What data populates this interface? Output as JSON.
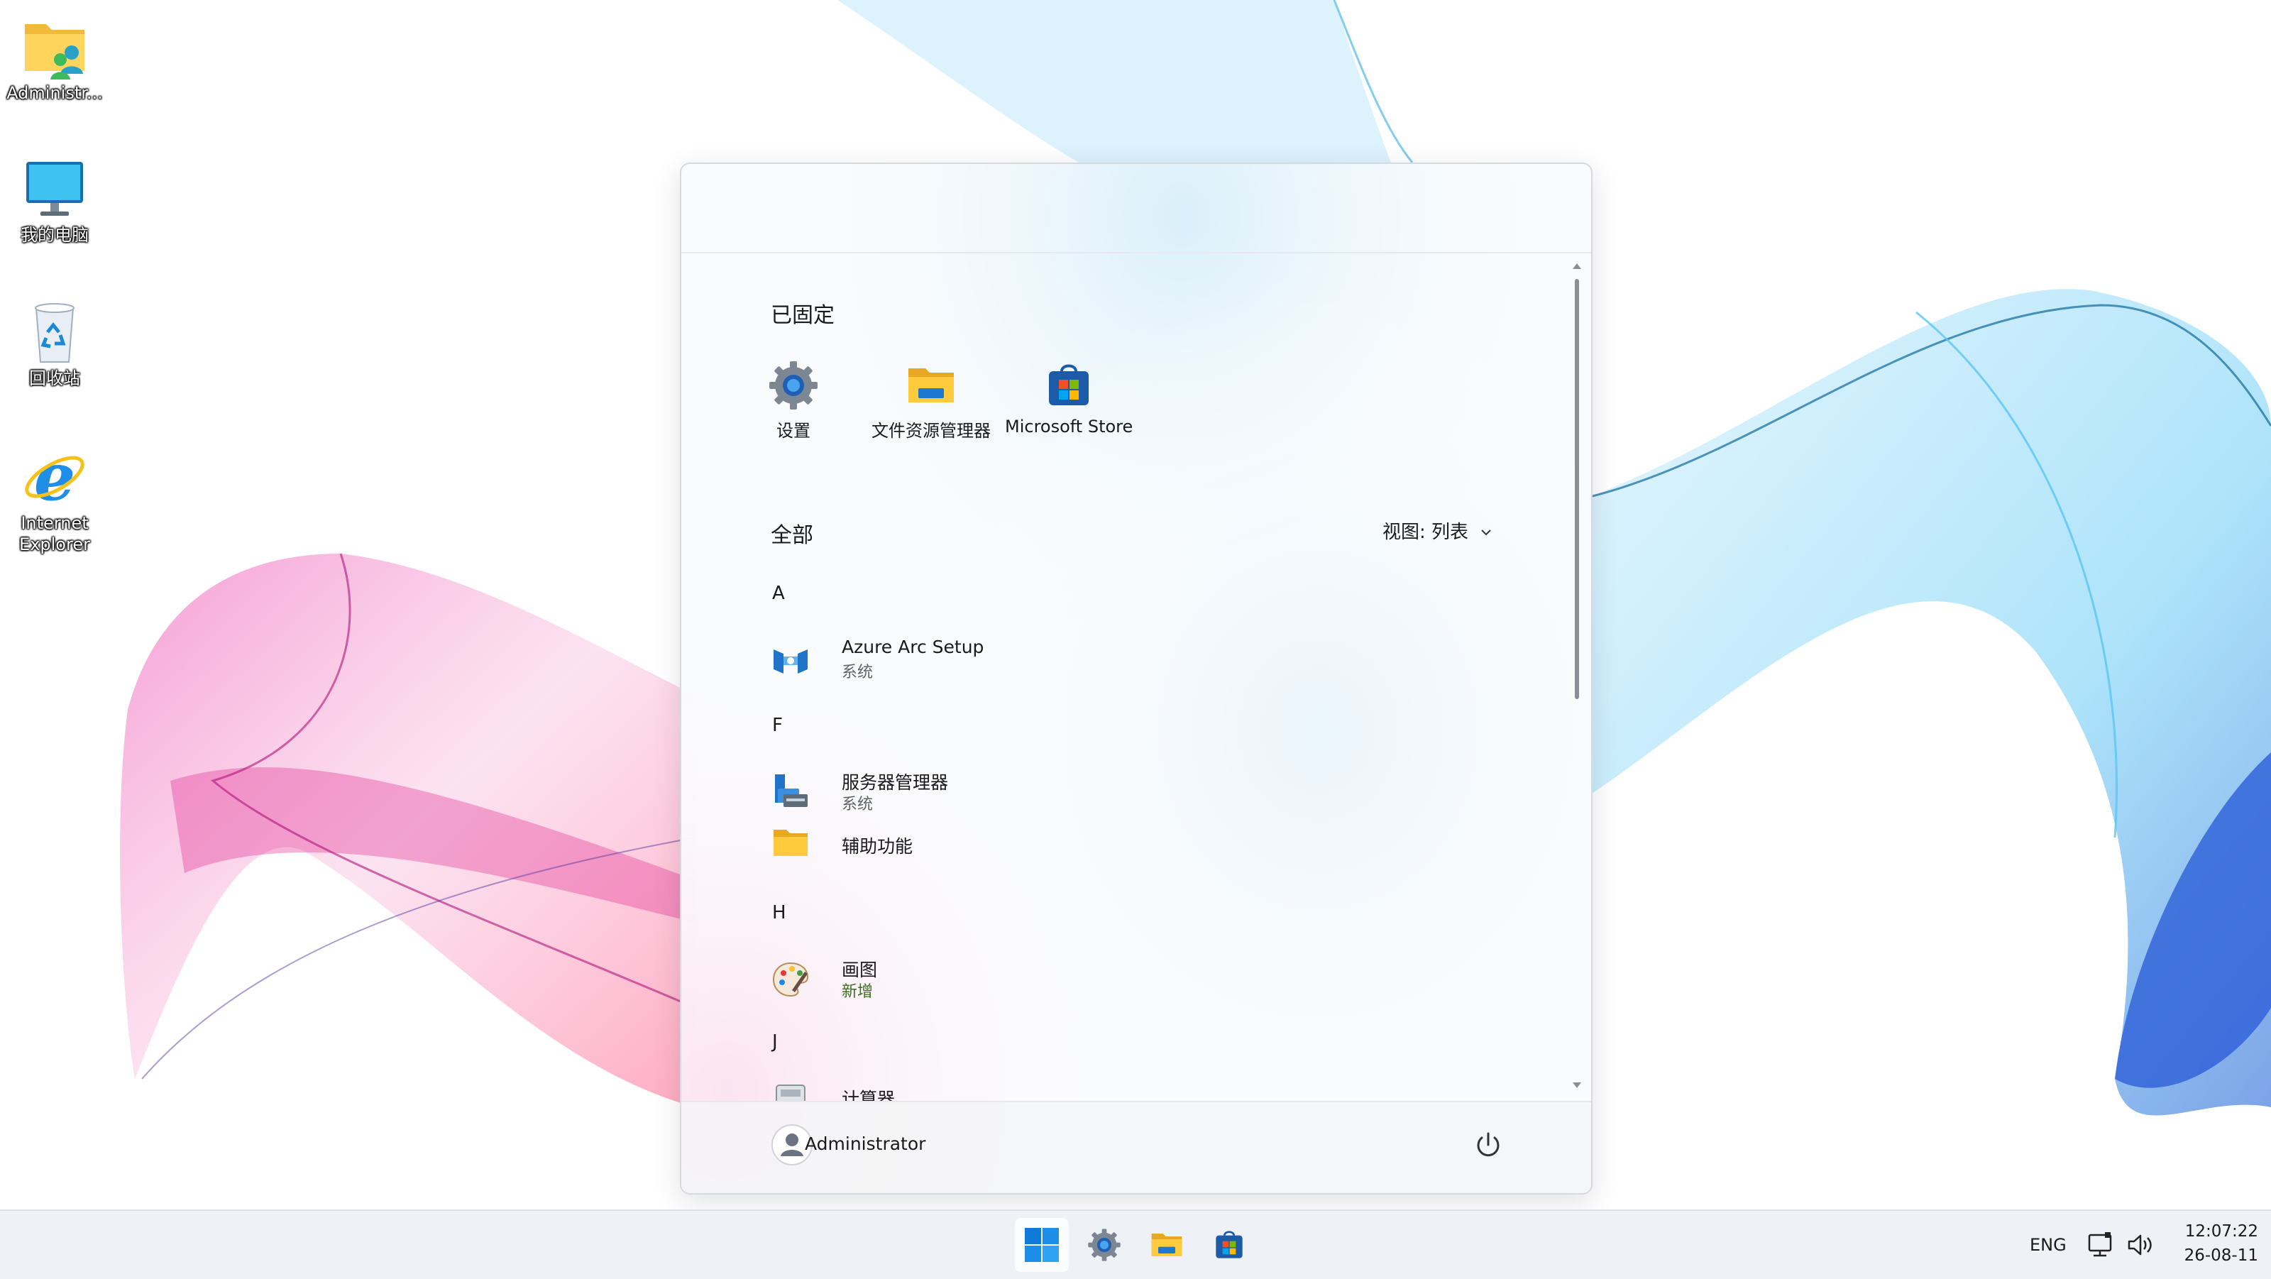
{
  "desktop": {
    "icons": [
      {
        "label": "Administr..."
      },
      {
        "label": "我的电脑"
      },
      {
        "label": "回收站"
      },
      {
        "label": "Internet Explorer"
      }
    ]
  },
  "start_menu": {
    "pinned_title": "已固定",
    "pinned": [
      {
        "label": "设置",
        "icon": "gear-icon"
      },
      {
        "label": "文件资源管理器",
        "icon": "folder-icon"
      },
      {
        "label": "Microsoft Store",
        "icon": "store-icon"
      }
    ],
    "all_title": "全部",
    "view_toggle": "视图: 列表",
    "groups": [
      {
        "letter": "A",
        "apps": [
          {
            "name": "Azure Arc Setup",
            "sub": "系统"
          }
        ]
      },
      {
        "letter": "F",
        "apps": [
          {
            "name": "服务器管理器",
            "sub": "系统"
          },
          {
            "name": "辅助功能",
            "sub": ""
          }
        ]
      },
      {
        "letter": "H",
        "apps": [
          {
            "name": "画图",
            "sub": "新增"
          }
        ]
      },
      {
        "letter": "J",
        "apps": [
          {
            "name": "计算器",
            "sub": ""
          }
        ]
      }
    ],
    "user_name": "Administrator"
  },
  "taskbar": {
    "apps": [
      "start-icon",
      "gear-icon",
      "folder-icon",
      "store-icon"
    ],
    "language": "ENG",
    "time": "12:07:22",
    "date": "26-08-11"
  },
  "colors": {
    "accent": "#0078d4",
    "pink_ribbon": "#e0288f",
    "cyan_ribbon": "#4fc3f7"
  }
}
